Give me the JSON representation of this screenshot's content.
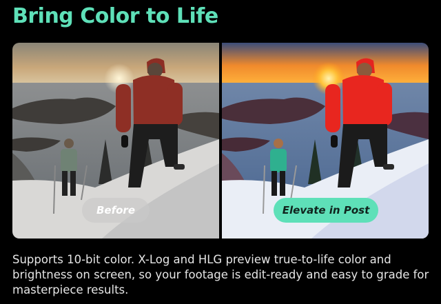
{
  "header": {
    "title": "Bring Color to Life"
  },
  "comparison": {
    "before_label": "Before",
    "after_label": "Elevate in Post"
  },
  "description": "Supports 10-bit color. X-Log and HLG preview true-to-life color and brightness on screen, so your footage is edit-ready and easy to grade for masterpiece results.",
  "colors": {
    "accent": "#5ee0b8",
    "background": "#000000",
    "before_pill": "#c8c8c8",
    "after_pill_text": "#10231d"
  }
}
